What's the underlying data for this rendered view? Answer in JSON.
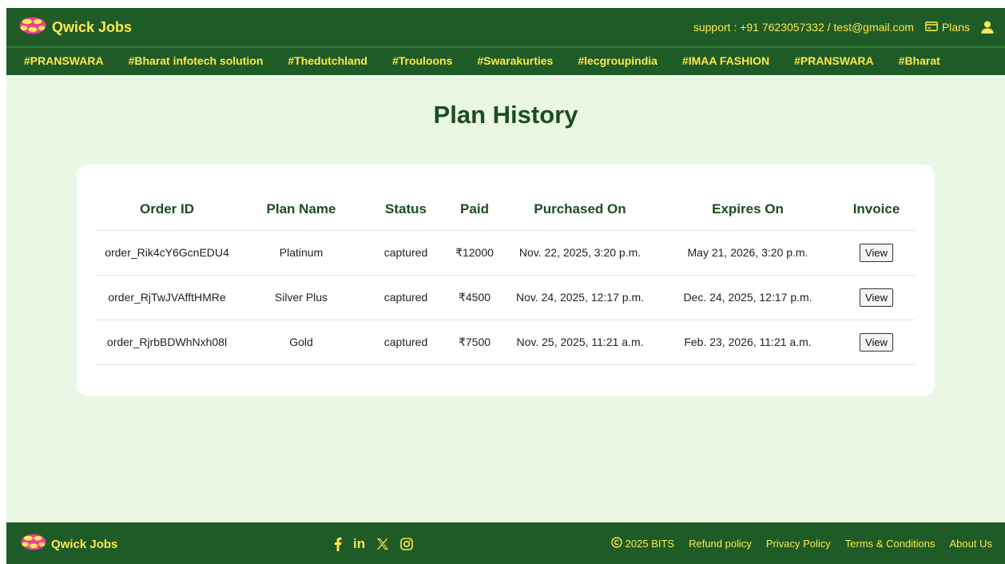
{
  "header": {
    "brand": "Qwick Jobs",
    "support_text": "support : +91 7623057332 / test@gmail.com",
    "plans_label": "Plans",
    "icons": [
      "logo-icon",
      "card-icon",
      "user-icon"
    ]
  },
  "tags": [
    "#PRANSWARA",
    "#Bharat infotech solution",
    "#Thedutchland",
    "#Trouloons",
    "#Swarakurties",
    "#lecgroupindia",
    "#IMAA FASHION",
    "#PRANSWARA",
    "#Bharat"
  ],
  "main": {
    "title": "Plan History",
    "table": {
      "headers": [
        "Order ID",
        "Plan Name",
        "Status",
        "Paid",
        "Purchased On",
        "Expires On",
        "Invoice"
      ],
      "rows": [
        {
          "order_id": "order_Rik4cY6GcnEDU4",
          "plan": "Platinum",
          "status": "captured",
          "paid": "₹12000",
          "purchased": "Nov. 22, 2025, 3:20 p.m.",
          "expires": "May 21, 2026, 3:20 p.m.",
          "invoice": "View"
        },
        {
          "order_id": "order_RjTwJVAfftHMRe",
          "plan": "Silver Plus",
          "status": "captured",
          "paid": "₹4500",
          "purchased": "Nov. 24, 2025, 12:17 p.m.",
          "expires": "Dec. 24, 2025, 12:17 p.m.",
          "invoice": "View"
        },
        {
          "order_id": "order_RjrbBDWhNxh08l",
          "plan": "Gold",
          "status": "captured",
          "paid": "₹7500",
          "purchased": "Nov. 25, 2025, 11:21 a.m.",
          "expires": "Feb. 23, 2026, 11:21 a.m.",
          "invoice": "View"
        }
      ]
    }
  },
  "footer": {
    "brand": "Qwick Jobs",
    "socials": [
      "facebook-icon",
      "linkedin-icon",
      "x-icon",
      "instagram-icon"
    ],
    "linkedin_text": "in",
    "copyright": "2025 BITS",
    "links": [
      "Refund policy",
      "Privacy Policy",
      "Terms & Conditions",
      "About Us"
    ]
  },
  "colors": {
    "brand_green": "#1f5b27",
    "accent_yellow": "#ffe94a",
    "page_bg": "#e9f7e4",
    "title_green": "#1c4d22"
  }
}
